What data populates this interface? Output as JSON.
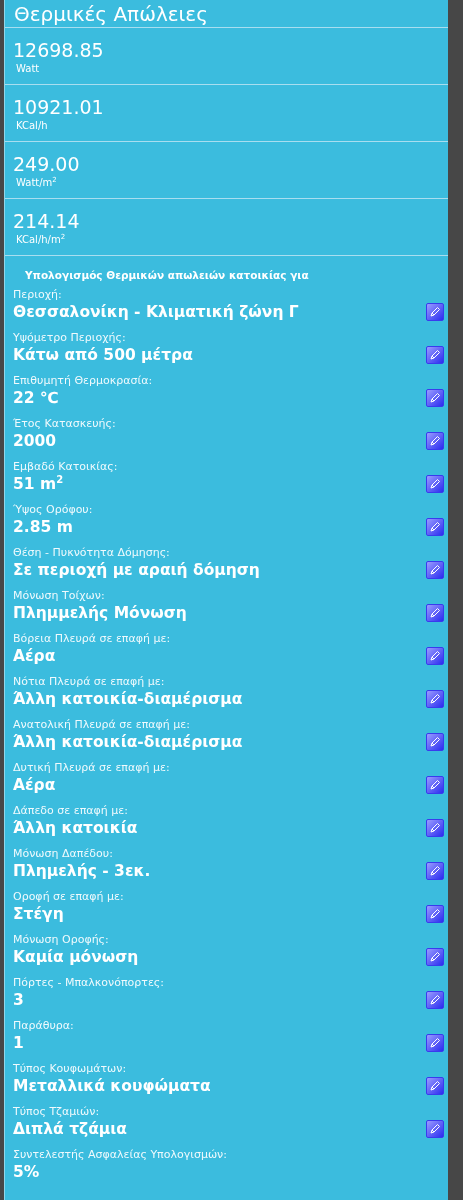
{
  "title": "Θερμικές Απώλειες",
  "results": [
    {
      "value": "12698.85",
      "unit": "Watt"
    },
    {
      "value": "10921.01",
      "unit": "KCal/h"
    },
    {
      "value": "249.00",
      "unit": "Watt/m$^{2}$"
    },
    {
      "value": "214.14",
      "unit": "KCal/h/m$^{2}$"
    }
  ],
  "inputs_heading": "Υπολογισμός Θερμικών απωλειών κατοικίας για",
  "inputs": [
    {
      "label": "Περιοχή:",
      "value": "Θεσσαλονίκη - Κλιματική ζώνη Γ",
      "editable": true
    },
    {
      "label": "Υψόμετρο Περιοχής:",
      "value": "Κάτω από 500 μέτρα",
      "editable": true
    },
    {
      "label": "Επιθυμητή Θερμοκρασία:",
      "value": "22 ℃",
      "editable": true
    },
    {
      "label": "Έτος Κατασκευής:",
      "value": "2000",
      "editable": true
    },
    {
      "label": "Εμβαδό Κατοικίας:",
      "value": "51 m$^{2}$",
      "editable": true
    },
    {
      "label": "Ύψος Ορόφου:",
      "value": "2.85 m",
      "editable": true
    },
    {
      "label": "Θέση - Πυκνότητα Δόμησης:",
      "value": "Σε περιοχή με αραιή δόμηση",
      "editable": true
    },
    {
      "label": "Μόνωση Τοίχων:",
      "value": "Πλημμελής Μόνωση",
      "editable": true
    },
    {
      "label": "Βόρεια Πλευρά σε επαφή με:",
      "value": "Αέρα",
      "editable": true
    },
    {
      "label": "Νότια Πλευρά σε επαφή με:",
      "value": "Άλλη κατοικία-διαμέρισμα",
      "editable": true
    },
    {
      "label": "Ανατολική Πλευρά σε επαφή με:",
      "value": "Άλλη κατοικία-διαμέρισμα",
      "editable": true
    },
    {
      "label": "Δυτική Πλευρά σε επαφή με:",
      "value": "Αέρα",
      "editable": true
    },
    {
      "label": "Δάπεδο σε επαφή με:",
      "value": "Άλλη κατοικία",
      "editable": true
    },
    {
      "label": "Μόνωση Δαπέδου:",
      "value": "Πλημελής - 3εκ.",
      "editable": true
    },
    {
      "label": "Οροφή σε επαφή με:",
      "value": "Στέγη",
      "editable": true
    },
    {
      "label": "Μόνωση Οροφής:",
      "value": "Καμία μόνωση",
      "editable": true
    },
    {
      "label": "Πόρτες - Μπαλκονόπορτες:",
      "value": "3",
      "editable": true
    },
    {
      "label": "Παράθυρα:",
      "value": "1",
      "editable": true
    },
    {
      "label": "Τύπος Κουφωμάτων:",
      "value": "Μεταλλικά κουφώματα",
      "editable": true
    },
    {
      "label": "Τύπος Τζαμιών:",
      "value": "Διπλά τζάμια",
      "editable": true
    },
    {
      "label": "Συντελεστής Ασφαλείας Υπολογισμών:",
      "value": "5%",
      "editable": false
    }
  ]
}
